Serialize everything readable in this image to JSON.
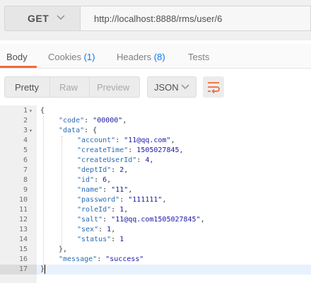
{
  "request": {
    "method": "GET",
    "url": "http://localhost:8888/rms/user/6"
  },
  "tabs": [
    {
      "label": "Body",
      "count": ""
    },
    {
      "label": "Cookies",
      "count": "(1)"
    },
    {
      "label": "Headers",
      "count": "(8)"
    },
    {
      "label": "Tests",
      "count": ""
    }
  ],
  "view_modes": [
    "Pretty",
    "Raw",
    "Preview"
  ],
  "format": "JSON",
  "code_lines": [
    {
      "num": "1",
      "fold": "▾",
      "text": "{"
    },
    {
      "num": "2",
      "fold": "",
      "indent": 1,
      "key": "\"code\"",
      "value": "\"00000\"",
      "vtype": "s",
      "trail": ","
    },
    {
      "num": "3",
      "fold": "▾",
      "indent": 1,
      "key": "\"data\"",
      "value": "{",
      "vtype": "p",
      "trail": ""
    },
    {
      "num": "4",
      "fold": "",
      "indent": 2,
      "key": "\"account\"",
      "value": "\"11@qq.com\"",
      "vtype": "s",
      "trail": ","
    },
    {
      "num": "5",
      "fold": "",
      "indent": 2,
      "key": "\"createTime\"",
      "value": "1505027845",
      "vtype": "n",
      "trail": ","
    },
    {
      "num": "6",
      "fold": "",
      "indent": 2,
      "key": "\"createUserId\"",
      "value": "4",
      "vtype": "n",
      "trail": ","
    },
    {
      "num": "7",
      "fold": "",
      "indent": 2,
      "key": "\"deptId\"",
      "value": "2",
      "vtype": "n",
      "trail": ","
    },
    {
      "num": "8",
      "fold": "",
      "indent": 2,
      "key": "\"id\"",
      "value": "6",
      "vtype": "n",
      "trail": ","
    },
    {
      "num": "9",
      "fold": "",
      "indent": 2,
      "key": "\"name\"",
      "value": "\"11\"",
      "vtype": "s",
      "trail": ","
    },
    {
      "num": "10",
      "fold": "",
      "indent": 2,
      "key": "\"password\"",
      "value": "\"111111\"",
      "vtype": "s",
      "trail": ","
    },
    {
      "num": "11",
      "fold": "",
      "indent": 2,
      "key": "\"roleId\"",
      "value": "1",
      "vtype": "n",
      "trail": ","
    },
    {
      "num": "12",
      "fold": "",
      "indent": 2,
      "key": "\"salt\"",
      "value": "\"11@qq.com1505027845\"",
      "vtype": "s",
      "trail": ","
    },
    {
      "num": "13",
      "fold": "",
      "indent": 2,
      "key": "\"sex\"",
      "value": "1",
      "vtype": "n",
      "trail": ","
    },
    {
      "num": "14",
      "fold": "",
      "indent": 2,
      "key": "\"status\"",
      "value": "1",
      "vtype": "n",
      "trail": ""
    },
    {
      "num": "15",
      "fold": "",
      "indent": 1,
      "text": "},"
    },
    {
      "num": "16",
      "fold": "",
      "indent": 1,
      "key": "\"message\"",
      "value": "\"success\"",
      "vtype": "s",
      "trail": ""
    },
    {
      "num": "17",
      "fold": "",
      "text": "}",
      "active": true
    }
  ],
  "colors": {
    "accent": "#f26b3a",
    "count": "#097bed",
    "key": "#2a6db2",
    "value": "#1a1aa6"
  },
  "icons": {
    "method_dropdown": "chevron-down-icon",
    "format_dropdown": "chevron-down-icon",
    "wrap": "wrap-lines-icon"
  }
}
